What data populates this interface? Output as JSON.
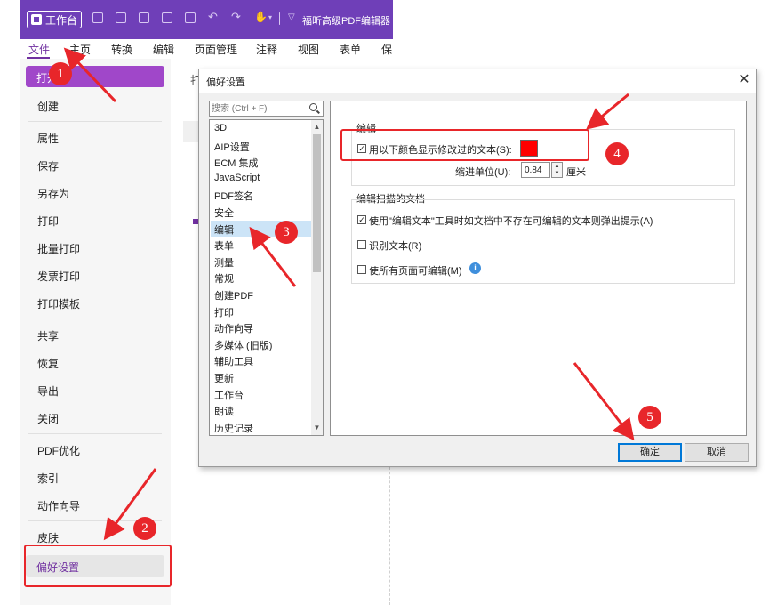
{
  "app": {
    "workspace_label": "工作台",
    "title": "福昕高级PDF编辑器"
  },
  "menubar": {
    "items": [
      "文件",
      "主页",
      "转换",
      "编辑",
      "页面管理",
      "注释",
      "视图",
      "表单",
      "保"
    ]
  },
  "left_panel": {
    "open_partial": "打开",
    "items_group1": [
      "创建"
    ],
    "items_group2": [
      "属性",
      "保存",
      "另存为",
      "打印",
      "批量打印",
      "发票打印",
      "打印模板"
    ],
    "items_group3": [
      "共享",
      "恢复",
      "导出",
      "关闭"
    ],
    "items_group4": [
      "PDF优化",
      "索引",
      "动作向导"
    ],
    "items_group5": [
      "皮肤"
    ],
    "preferences": "偏好设置"
  },
  "background": {
    "partial_text": "打"
  },
  "dialog": {
    "title": "偏好设置",
    "close_glyph": "✕",
    "search_placeholder": "搜索 (Ctrl + F)",
    "categories": [
      "3D",
      "AIP设置",
      "ECM 集成",
      "JavaScript",
      "PDF签名",
      "安全",
      "编辑",
      "表单",
      "测量",
      "常规",
      "创建PDF",
      "打印",
      "动作向导",
      "多媒体 (旧版)",
      "辅助工具",
      "更新",
      "工作台",
      "朗读",
      "历史记录"
    ],
    "selected_category": "编辑",
    "edit_group": {
      "title": "编辑",
      "show_color_label": "用以下颜色显示修改过的文本(S):",
      "show_color_checked": true,
      "highlight_color": "#ff0000",
      "indent_label": "缩进单位(U):",
      "indent_value": "0.84",
      "indent_unit": "厘米"
    },
    "scan_group": {
      "title": "编辑扫描的文档",
      "options": [
        {
          "label": "使用\"编辑文本\"工具时如文档中不存在可编辑的文本则弹出提示(A)",
          "checked": true
        },
        {
          "label": "识别文本(R)",
          "checked": false
        },
        {
          "label": "使所有页面可编辑(M)",
          "checked": false
        }
      ]
    },
    "ok_label": "确定",
    "cancel_label": "取消"
  },
  "annotations": {
    "color": "#e8262a",
    "badges": [
      "1",
      "2",
      "3",
      "4",
      "5"
    ]
  },
  "colors": {
    "brand": "#6f3fb8",
    "accent": "#a047c9",
    "active_text": "#7030a0",
    "selection": "#cce4f7"
  }
}
